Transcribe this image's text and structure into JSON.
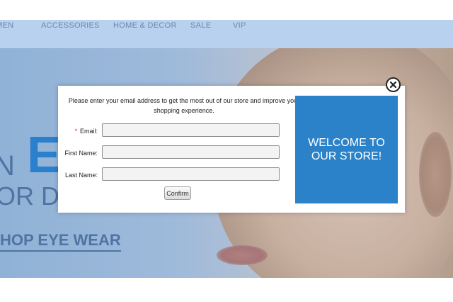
{
  "nav": {
    "items": [
      "MEN",
      "ACCESSORIES",
      "HOME & DECOR",
      "SALE",
      "VIP"
    ]
  },
  "hero": {
    "line1_part1": "N",
    "line1_part2": "E",
    "line2": "OR D",
    "cta": "HOP EYE WEAR"
  },
  "modal": {
    "intro": "Please enter your email address to get the most out of our store and improve your shopping experience.",
    "email_required_mark": "*",
    "email_label": "Email:",
    "email_value": "",
    "firstname_label": "First Name:",
    "firstname_value": "",
    "lastname_label": "Last Name:",
    "lastname_value": "",
    "confirm_label": "Confirm",
    "welcome": "WELCOME TO OUR STORE!"
  },
  "colors": {
    "nav_bg": "#b7d1ee",
    "accent": "#2b82c9",
    "required": "#dd2222"
  },
  "icons": {
    "close": "close-circle-icon"
  }
}
